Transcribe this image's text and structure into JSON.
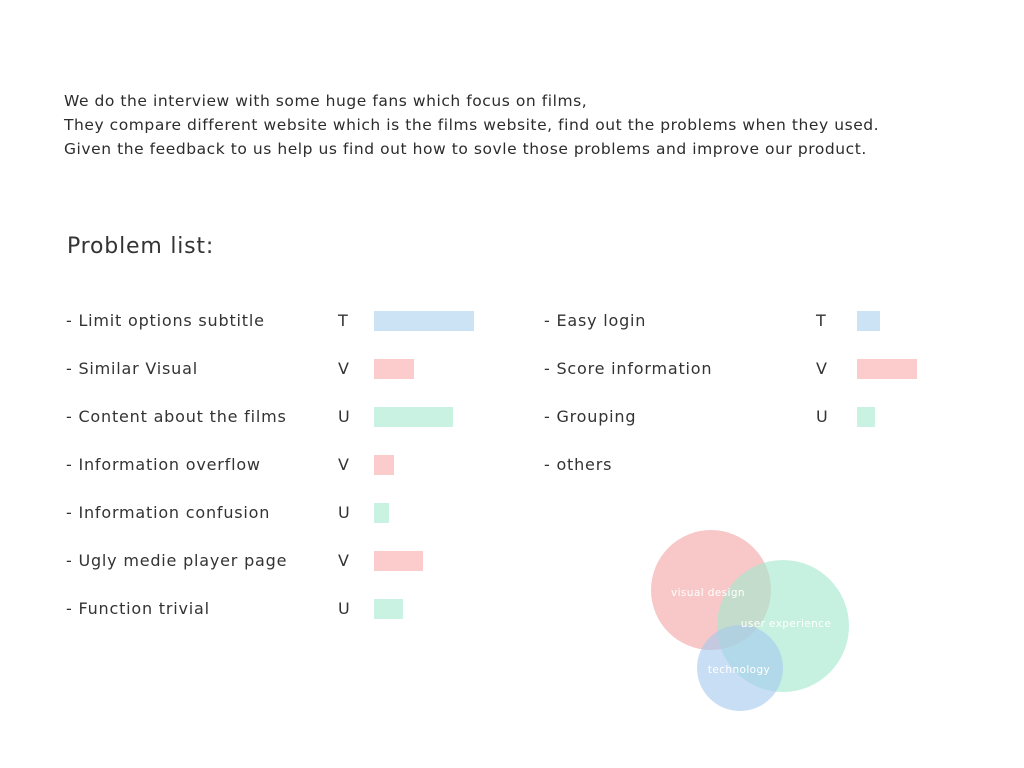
{
  "intro": {
    "lines": [
      "We do the interview with some huge fans which focus on films,",
      "They compare different website which is the films website, find out the problems when they used.",
      "Given the feedback to us help us find out how to sovle those problems and improve our product."
    ]
  },
  "heading": "Problem list:",
  "colors": {
    "T": "#cce3f5",
    "V": "#fccccc",
    "U": "#c9f2e3"
  },
  "chart_data": [
    {
      "type": "bar",
      "orientation": "horizontal",
      "title": "Problem list:",
      "categories": [
        "- Limit options subtitle",
        "- Similar Visual",
        "- Content about the films",
        "- Information overflow",
        "- Information confusion",
        "- Ugly medie player page",
        "- Function trivial",
        "- Easy login",
        "- Score information",
        "- Grouping",
        "- others"
      ],
      "groups": [
        "T",
        "V",
        "U",
        "V",
        "U",
        "V",
        "U",
        "T",
        "V",
        "U",
        null
      ],
      "values": [
        100,
        40,
        79,
        20,
        15,
        49,
        29,
        23,
        60,
        18,
        null
      ],
      "axis": "none",
      "legend": "none"
    },
    {
      "type": "venn",
      "sets": [
        {
          "name": "visual design",
          "color": "#f4a7a7"
        },
        {
          "name": "user experience",
          "color": "#a3e8cf"
        },
        {
          "name": "technology",
          "color": "#a6c9ee"
        }
      ]
    }
  ]
}
